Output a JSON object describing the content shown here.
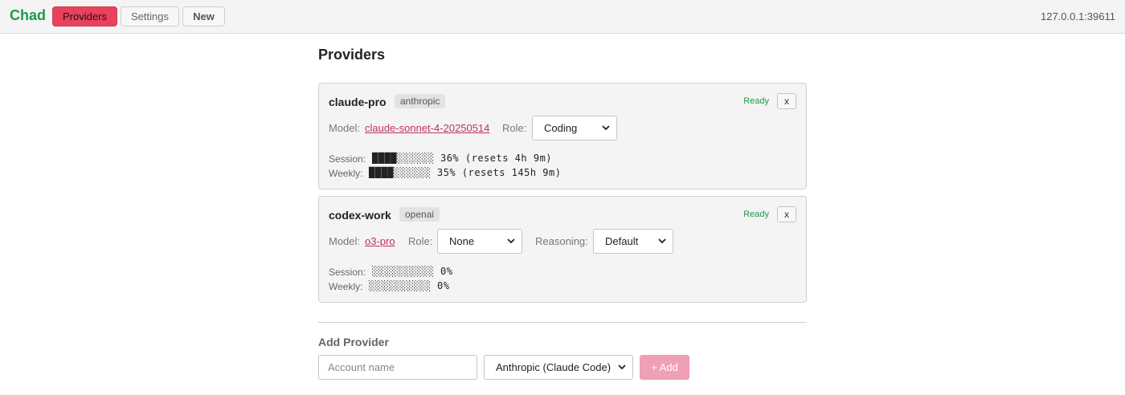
{
  "app": {
    "brand": "Chad",
    "address": "127.0.0.1:39611"
  },
  "nav": {
    "providers": "Providers",
    "settings": "Settings",
    "new": "New"
  },
  "page": {
    "title": "Providers"
  },
  "labels": {
    "model": "Model:",
    "role": "Role:",
    "reasoning": "Reasoning:",
    "session": "Session:",
    "weekly": "Weekly:",
    "close": "x"
  },
  "providers": [
    {
      "name": "claude-pro",
      "type": "anthropic",
      "status": "Ready",
      "model": "claude-sonnet-4-20250514",
      "role": "Coding",
      "session": {
        "bar": "████░░░░░░",
        "percent": 36,
        "text": "36% (resets 4h 9m)"
      },
      "weekly": {
        "bar": "████░░░░░░",
        "percent": 35,
        "text": "35% (resets 145h 9m)"
      }
    },
    {
      "name": "codex-work",
      "type": "openai",
      "status": "Ready",
      "model": "o3-pro",
      "role": "None",
      "reasoning": "Default",
      "session": {
        "bar": "░░░░░░░░░░",
        "percent": 0,
        "text": "0%"
      },
      "weekly": {
        "bar": "░░░░░░░░░░",
        "percent": 0,
        "text": "0%"
      }
    }
  ],
  "add": {
    "title": "Add Provider",
    "placeholder": "Account name",
    "provider_select": "Anthropic (Claude Code)",
    "button": "+ Add"
  },
  "colors": {
    "brand": "#1c9a46",
    "accent": "#e8425e",
    "link": "#c0306a",
    "ready": "#1c9a46"
  },
  "icons": {
    "select": "chevron-down-icon"
  }
}
